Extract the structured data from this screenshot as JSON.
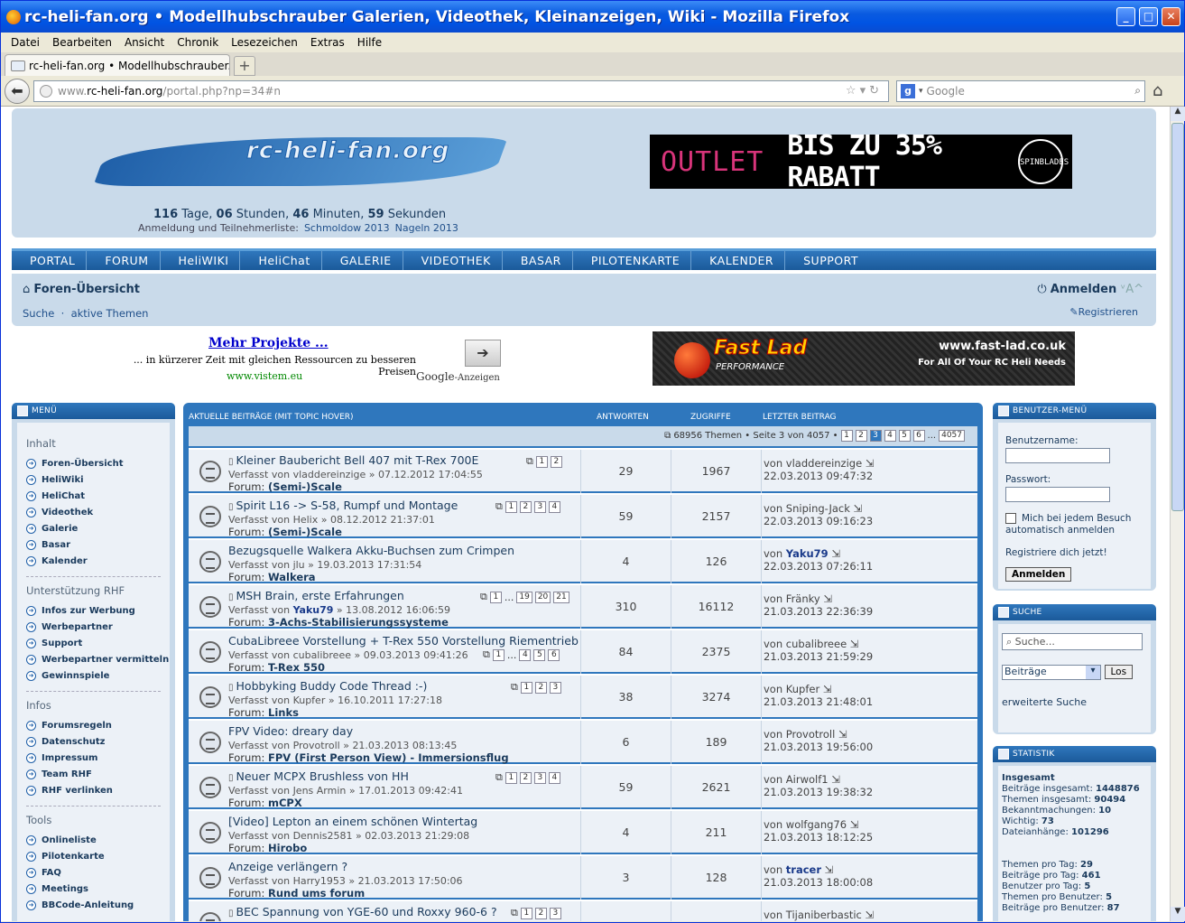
{
  "window": {
    "title": "rc-heli-fan.org • Modellhubschrauber Galerien, Videothek, Kleinanzeigen, Wiki - Mozilla Firefox"
  },
  "menubar": [
    "Datei",
    "Bearbeiten",
    "Ansicht",
    "Chronik",
    "Lesezeichen",
    "Extras",
    "Hilfe"
  ],
  "tab": {
    "label": "rc-heli-fan.org • Modellhubschrauber..."
  },
  "url": {
    "prefix": "www.",
    "domain": "rc-heli-fan.org",
    "path": "/portal.php?np=34#n"
  },
  "search": {
    "placeholder": "Google"
  },
  "header": {
    "logo_text": "rc-heli-fan.org",
    "countdown": {
      "days": "116",
      "days_label": " Tage, ",
      "hours": "06",
      "hours_label": " Stunden, ",
      "minutes": "46",
      "minutes_label": " Minuten, ",
      "seconds": "59",
      "seconds_label": " Sekunden"
    },
    "registration_label": "Anmeldung und Teilnehmerliste:",
    "reg_link1": "Schmoldow 2013",
    "reg_link2": "Nageln 2013",
    "banner_outlet": "OUTLET",
    "banner_rabatt": "BIS ZU 35% RABATT",
    "banner_brand": "SPINBLADES"
  },
  "mainnav": [
    "PORTAL",
    "FORUM",
    "HeliWIKI",
    "HeliChat",
    "GALERIE",
    "VIDEOTHEK",
    "BASAR",
    "PILOTENKARTE",
    "KALENDER",
    "SUPPORT"
  ],
  "subnav": {
    "forums": "Foren-Übersicht",
    "login": "Anmelden",
    "fontsize": "ᵛA^",
    "search": "Suche",
    "sep": "·",
    "active": "aktive Themen",
    "register": "Registrieren"
  },
  "ad": {
    "title": "Mehr Projekte ...",
    "desc": "... in kürzerer Zeit mit gleichen Ressourcen zu besseren Preisen",
    "url": "www.vistem.eu",
    "google": "Google",
    "anzeigen": "-Anzeigen"
  },
  "banner2": {
    "brand": "Fast Lad",
    "perf": "PERFORMANCE",
    "url": "www.fast-lad.co.uk",
    "slogan": "For All Of Your RC Heli Needs"
  },
  "leftmenu": {
    "header": "MENÜ",
    "sections": [
      {
        "title": "Inhalt",
        "items": [
          "Foren-Übersicht",
          "HeliWiki",
          "HeliChat",
          "Videothek",
          "Galerie",
          "Basar",
          "Kalender"
        ]
      },
      {
        "title": "Unterstützung RHF",
        "items": [
          "Infos zur Werbung",
          "Werbepartner",
          "Support",
          "Werbepartner vermitteln",
          "Gewinnspiele"
        ]
      },
      {
        "title": "Infos",
        "items": [
          "Forumsregeln",
          "Datenschutz",
          "Impressum",
          "Team RHF",
          "RHF verlinken"
        ]
      },
      {
        "title": "Tools",
        "items": [
          "Onlineliste",
          "Pilotenkarte",
          "FAQ",
          "Meetings",
          "BBCode-Anleitung"
        ]
      }
    ]
  },
  "center": {
    "header": {
      "title": "AKTUELLE BEITRÄGE (MIT TOPIC HOVER)",
      "answers": "ANTWORTEN",
      "views": "ZUGRIFFE",
      "last": "LETZTER BEITRAG"
    },
    "pagination": {
      "summary": "68956 Themen • Seite 3 von 4057 •",
      "pages": [
        "1",
        "2",
        "3",
        "4",
        "5",
        "6",
        "...",
        "4057"
      ],
      "current": "3"
    },
    "topics": [
      {
        "title": "Kleiner Baubericht Bell 407 mit T-Rex 700E",
        "attach": true,
        "by": "vladdereinzige",
        "date": "07.12.2012 17:04:55",
        "forum": "(Semi-)Scale",
        "pages": [
          "1",
          "2"
        ],
        "answers": "29",
        "views": "1967",
        "last_by": "vladdereinzige",
        "last_date": "22.03.2013 09:47:32"
      },
      {
        "title": "Spirit L16 -> S-58, Rumpf und Montage",
        "attach": true,
        "by": "Helix",
        "date": "08.12.2012 21:37:01",
        "forum": "(Semi-)Scale",
        "pages": [
          "1",
          "2",
          "3",
          "4"
        ],
        "answers": "59",
        "views": "2157",
        "last_by": "Sniping-Jack",
        "last_date": "22.03.2013 09:16:23"
      },
      {
        "title": "Bezugsquelle Walkera Akku-Buchsen zum Crimpen",
        "attach": false,
        "by": "jlu",
        "date": "19.03.2013 17:31:54",
        "forum": "Walkera",
        "pages": [],
        "answers": "4",
        "views": "126",
        "last_by": "Yaku79",
        "last_hl": true,
        "last_date": "22.03.2013 07:26:11"
      },
      {
        "title": "MSH Brain, erste Erfahrungen",
        "attach": true,
        "by": "Yaku79",
        "by_hl": true,
        "date": "13.08.2012 16:06:59",
        "forum": "3-Achs-Stabilisierungssysteme",
        "pages": [
          "1",
          "...",
          "19",
          "20",
          "21"
        ],
        "answers": "310",
        "views": "16112",
        "last_by": "Fränky",
        "last_date": "21.03.2013 22:36:39"
      },
      {
        "title": "CubaLibreee Vorstellung + T-Rex 550 Vorstellung Riementrieb",
        "attach": false,
        "by": "cubalibreee",
        "date": "09.03.2013 09:41:26",
        "forum": "T-Rex 550",
        "pages": [
          "1",
          "...",
          "4",
          "5",
          "6"
        ],
        "pages_inline": true,
        "answers": "84",
        "views": "2375",
        "last_by": "cubalibreee",
        "last_date": "21.03.2013 21:59:29"
      },
      {
        "title": "Hobbyking Buddy Code Thread :-)",
        "attach": true,
        "by": "Kupfer",
        "date": "16.10.2011 17:27:18",
        "forum": "Links",
        "pages": [
          "1",
          "2",
          "3"
        ],
        "answers": "38",
        "views": "3274",
        "last_by": "Kupfer",
        "last_date": "21.03.2013 21:48:01"
      },
      {
        "title": "FPV Video: dreary day",
        "attach": false,
        "by": "Provotroll",
        "date": "21.03.2013 08:13:45",
        "forum": "FPV (First Person View) - Immersionsflug",
        "pages": [],
        "answers": "6",
        "views": "189",
        "last_by": "Provotroll",
        "last_date": "21.03.2013 19:56:00"
      },
      {
        "title": "Neuer MCPX Brushless von HH",
        "attach": true,
        "by": "Jens Armin",
        "date": "17.01.2013 09:42:41",
        "forum": "mCPX",
        "pages": [
          "1",
          "2",
          "3",
          "4"
        ],
        "answers": "59",
        "views": "2621",
        "last_by": "Airwolf1",
        "last_date": "21.03.2013 19:38:32"
      },
      {
        "title": "[Video] Lepton an einem schönen Wintertag",
        "attach": false,
        "by": "Dennis2581",
        "date": "02.03.2013 21:29:08",
        "forum": "Hirobo",
        "pages": [],
        "answers": "4",
        "views": "211",
        "last_by": "wolfgang76",
        "last_date": "21.03.2013 18:12:25"
      },
      {
        "title": "Anzeige verlängern ?",
        "attach": false,
        "by": "Harry1953",
        "date": "21.03.2013 17:50:06",
        "forum": "Rund ums forum",
        "pages": [],
        "answers": "3",
        "views": "128",
        "last_by": "tracer",
        "last_hl": true,
        "last_date": "21.03.2013 18:00:08"
      },
      {
        "title": "BEC Spannung von YGE-60 und Roxxy 960-6 ?",
        "attach": true,
        "by": "",
        "date": "",
        "forum": "",
        "pages": [
          "1",
          "2",
          "3"
        ],
        "answers": "",
        "views": "",
        "last_by": "Tijaniberbastic",
        "last_date": ""
      }
    ],
    "by_prefix": "Verfasst von",
    "forum_prefix": "Forum:",
    "von": "von"
  },
  "usermenu": {
    "header": "BENUTZER-MENÜ",
    "username_label": "Benutzername:",
    "password_label": "Passwort:",
    "remember": "Mich bei jedem Besuch automatisch anmelden",
    "register": "Registriere dich jetzt!",
    "login_button": "Anmelden"
  },
  "searchpanel": {
    "header": "SUCHE",
    "placeholder": "Suche...",
    "select": "Beiträge",
    "go": "Los",
    "advanced": "erweiterte Suche"
  },
  "stats": {
    "header": "STATISTIK",
    "total_label": "Insgesamt",
    "lines": [
      {
        "label": "Beiträge insgesamt:",
        "value": "1448876"
      },
      {
        "label": "Themen insgesamt:",
        "value": "90494"
      },
      {
        "label": "Bekanntmachungen:",
        "value": "10"
      },
      {
        "label": "Wichtig:",
        "value": "73"
      },
      {
        "label": "Dateianhänge:",
        "value": "101296"
      }
    ],
    "lines2": [
      {
        "label": "Themen pro Tag:",
        "value": "29"
      },
      {
        "label": "Beiträge pro Tag:",
        "value": "461"
      },
      {
        "label": "Benutzer pro Tag:",
        "value": "5"
      },
      {
        "label": "Themen pro Benutzer:",
        "value": "5"
      },
      {
        "label": "Beiträge pro Benutzer:",
        "value": "87"
      }
    ]
  }
}
